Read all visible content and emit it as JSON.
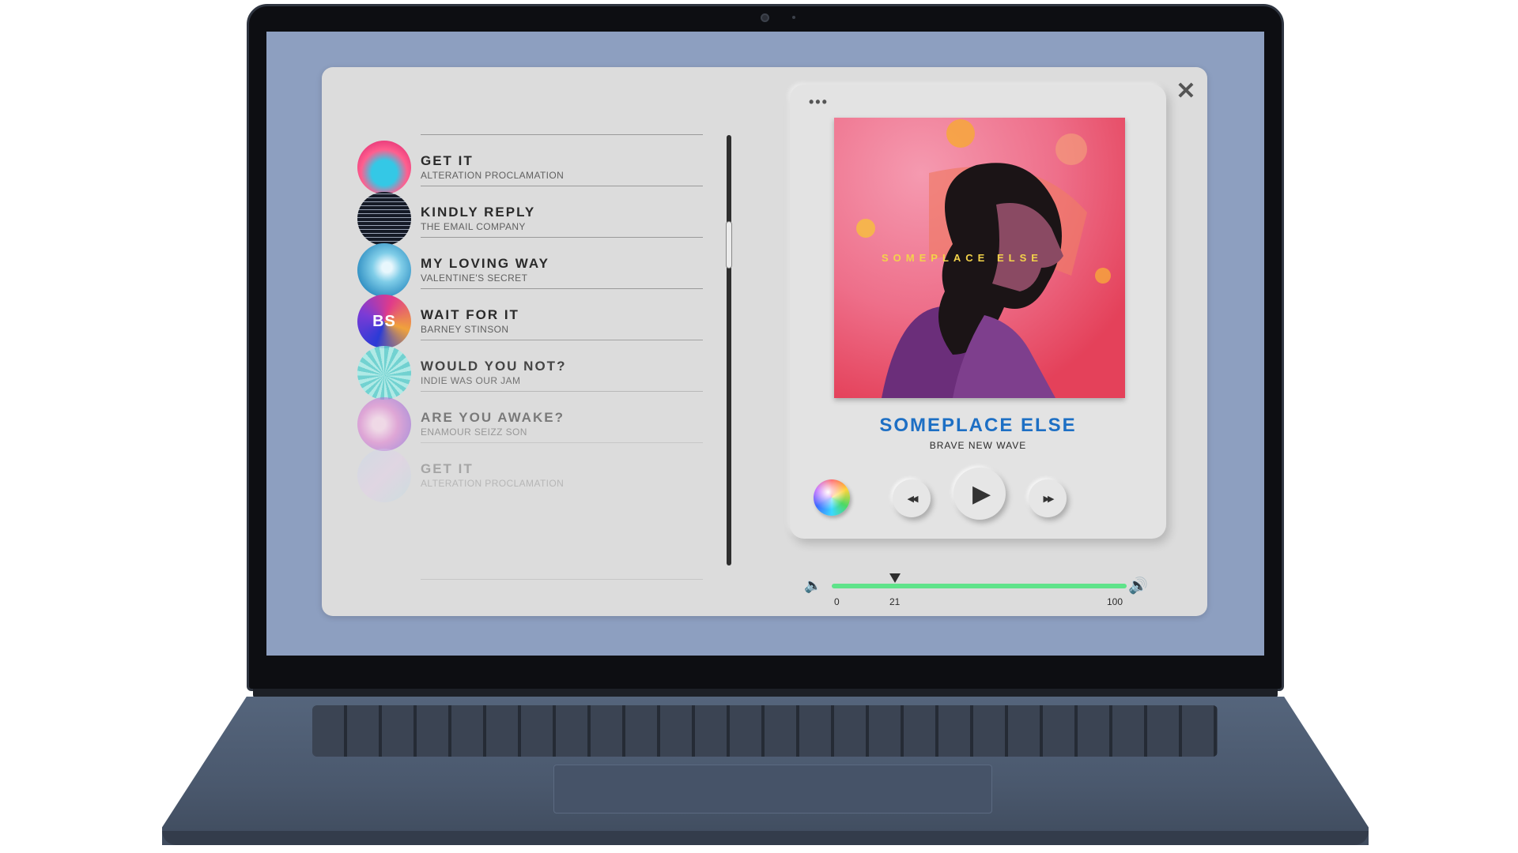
{
  "window": {
    "close_glyph": "✕",
    "menu_glyph": "•••"
  },
  "playlist": {
    "tracks": [
      {
        "title": "GET IT",
        "artist": "ALTERATION PROCLAMATION",
        "art": "neon-portrait"
      },
      {
        "title": "KINDLY REPLY",
        "artist": "THE EMAIL COMPANY",
        "art": "dark-text-grid"
      },
      {
        "title": "MY LOVING WAY",
        "artist": "VALENTINE'S SECRET",
        "art": "blue-splash"
      },
      {
        "title": "WAIT FOR IT",
        "artist": "BARNEY STINSON",
        "art": "bs-logo",
        "art_text": "BS"
      },
      {
        "title": "WOULD YOU NOT?",
        "artist": "INDIE WAS OUR JAM",
        "art": "teal-coral"
      },
      {
        "title": "ARE YOU AWAKE?",
        "artist": "ENAMOUR SEIZZ SON",
        "art": "pink-glow"
      },
      {
        "title": "GET IT",
        "artist": "ALTERATION PROCLAMATION",
        "art": "pastel-swirl"
      }
    ]
  },
  "player": {
    "cover_text": "SOMEPLACE ELSE",
    "song_title": "SOMEPLACE ELSE",
    "song_artist": "BRAVE NEW WAVE",
    "prev_glyph": "◀◀",
    "play_glyph": "▶",
    "next_glyph": "▶▶"
  },
  "volume": {
    "value": 21,
    "min_label": "0",
    "value_label": "21",
    "max_label": "100",
    "low_icon": "volume-low-icon",
    "high_icon": "volume-high-icon"
  },
  "colors": {
    "desktop": "#8d9fc0",
    "title_accent": "#1d6fc4",
    "volume_fill": "#5fe38a"
  }
}
